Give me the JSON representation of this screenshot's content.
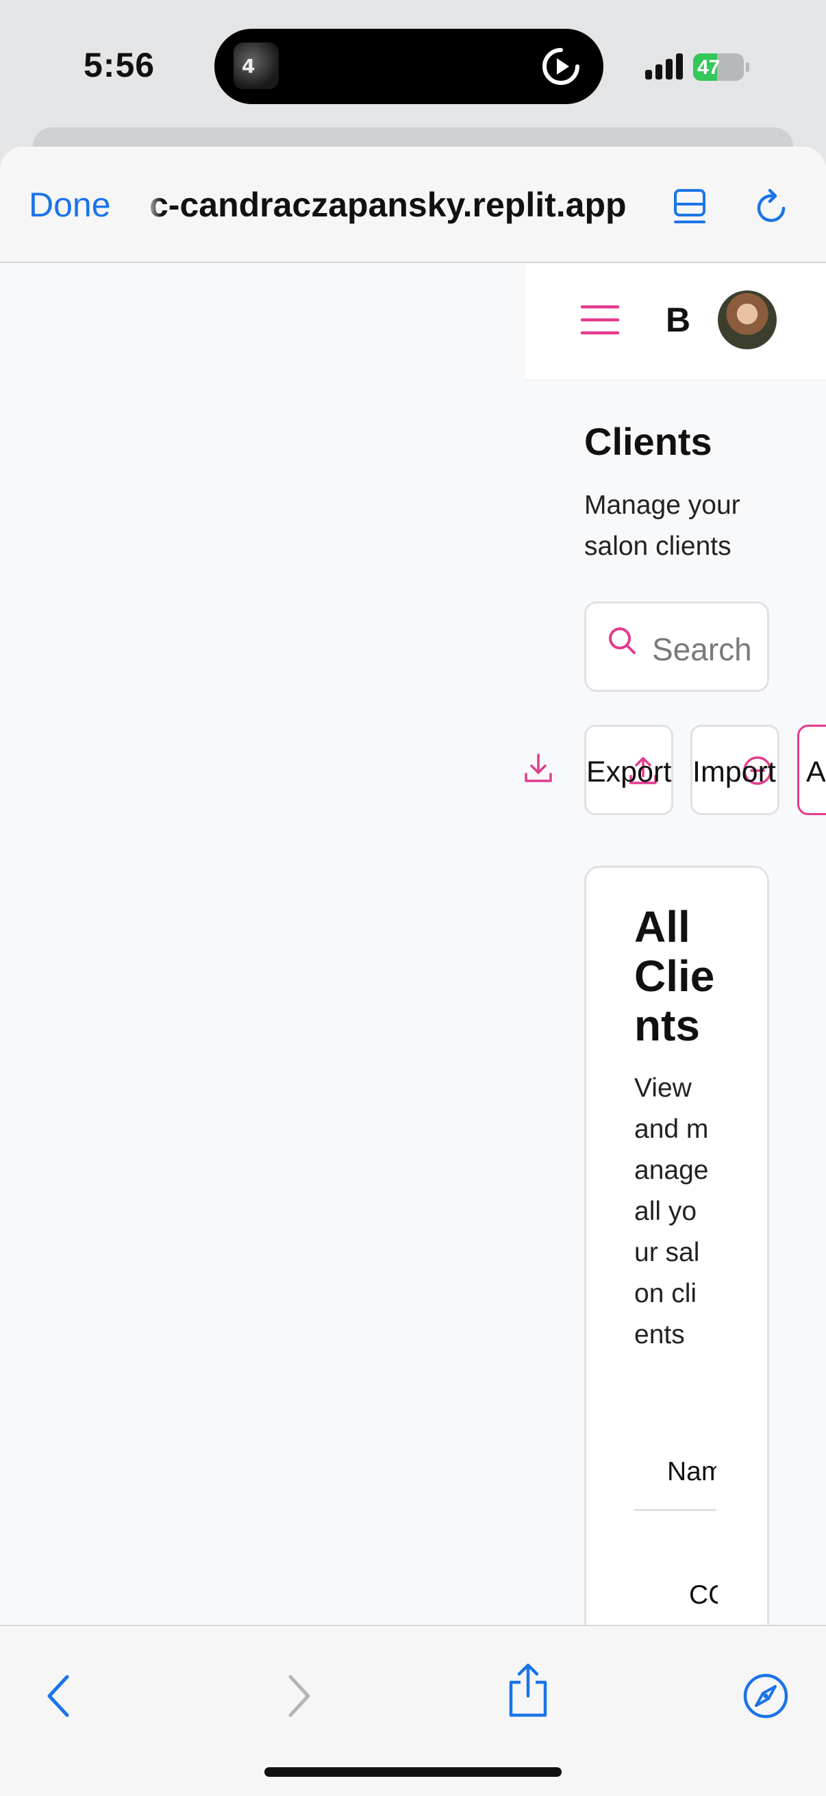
{
  "status_bar": {
    "time": "5:56",
    "battery_text": "47",
    "battery_level": 0.47,
    "island_thumb_text": "4"
  },
  "browser": {
    "done_label": "Done",
    "url": "c-candraczapansky.replit.app",
    "icons": {
      "reader": "reader-mode-icon",
      "reload": "reload-icon",
      "back": "chevron-left-icon",
      "forward": "chevron-right-icon",
      "share": "share-icon",
      "safari": "compass-icon"
    },
    "accent_color": "#1a74e8",
    "forward_disabled_color": "#b5b5b8"
  },
  "app": {
    "brand_letter": "B",
    "accent_color": "#e33b8e",
    "page_title": "Clients",
    "page_subtitle": "Manage your salon clients",
    "search": {
      "placeholder": "Search",
      "value": ""
    },
    "actions": {
      "export_label": "Export C",
      "import_label": "Import C",
      "add_label": "Ad"
    },
    "card": {
      "title": "All Clients",
      "description": "View and manage all your salon clients",
      "column_header": "Name",
      "first_cell": "CC"
    }
  }
}
